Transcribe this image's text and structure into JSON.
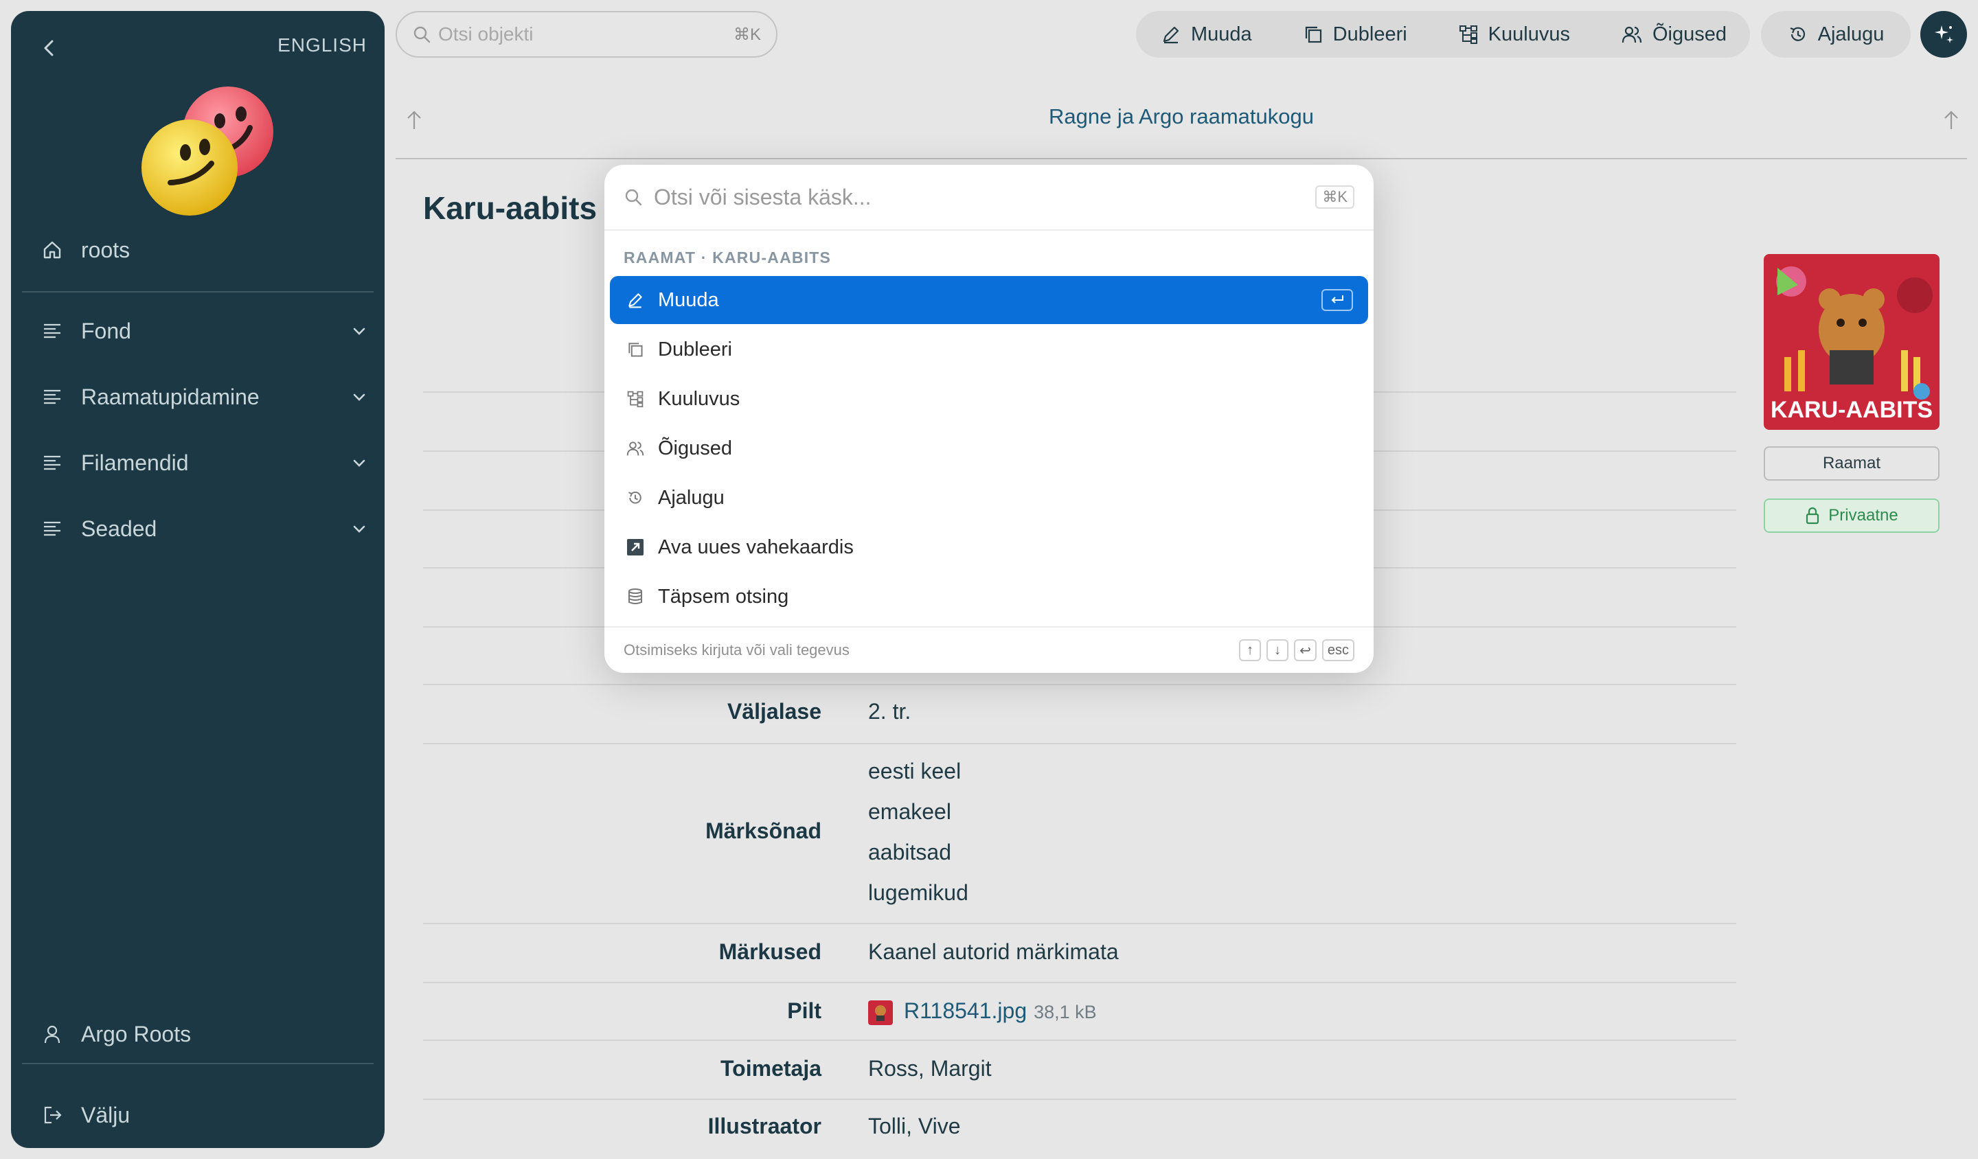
{
  "sidebar": {
    "language": "ENGLISH",
    "home_label": "roots",
    "items": [
      {
        "label": "Fond"
      },
      {
        "label": "Raamatupidamine"
      },
      {
        "label": "Filamendid"
      },
      {
        "label": "Seaded"
      }
    ],
    "user_label": "Argo Roots",
    "logout_label": "Välju"
  },
  "topbar": {
    "search_placeholder": "Otsi objekti",
    "search_shortcut": "⌘K",
    "actions": [
      {
        "label": "Muuda",
        "icon": "pencil-icon"
      },
      {
        "label": "Dubleeri",
        "icon": "duplicate-icon"
      },
      {
        "label": "Kuuluvus",
        "icon": "hierarchy-icon"
      },
      {
        "label": "Õigused",
        "icon": "users-icon"
      }
    ],
    "history_label": "Ajalugu"
  },
  "breadcrumb": {
    "title": "Ragne ja Argo raamatukogu"
  },
  "entity": {
    "title": "Karu-aabits",
    "type_badge": "Raamat",
    "access_badge": "Privaatne",
    "cover_text": "KARU-AABITS",
    "fields": {
      "edition_label": "Väljalase",
      "edition_value": "2. tr.",
      "keywords_label": "Märksõnad",
      "keywords": [
        "eesti keel",
        "emakeel",
        "aabitsad",
        "lugemikud"
      ],
      "notes_label": "Märkused",
      "notes_value": "Kaanel autorid märkimata",
      "image_label": "Pilt",
      "image_file": "R118541.jpg",
      "image_size": "38,1 kB",
      "editor_label": "Toimetaja",
      "editor_value": "Ross, Margit",
      "illustrator_label": "Illustraator",
      "illustrator_value": "Tolli, Vive"
    }
  },
  "palette": {
    "placeholder": "Otsi või sisesta käsk...",
    "shortcut": "⌘K",
    "group_label": "RAAMAT · KARU-AABITS",
    "items": [
      {
        "label": "Muuda",
        "icon": "pencil-icon"
      },
      {
        "label": "Dubleeri",
        "icon": "duplicate-icon"
      },
      {
        "label": "Kuuluvus",
        "icon": "hierarchy-icon"
      },
      {
        "label": "Õigused",
        "icon": "users-icon"
      },
      {
        "label": "Ajalugu",
        "icon": "history-icon"
      },
      {
        "label": "Ava uues vahekaardis",
        "icon": "external-link-icon"
      },
      {
        "label": "Täpsem otsing",
        "icon": "advanced-search-icon"
      }
    ],
    "footer_hint": "Otsimiseks kirjuta või vali tegevus",
    "footer_keys": [
      "↑",
      "↓",
      "↩",
      "esc"
    ]
  },
  "colors": {
    "sidebar_bg": "#1b3844",
    "accent": "#0a6fd8",
    "link": "#1e5a78",
    "private_green": "#2e8b4e"
  }
}
